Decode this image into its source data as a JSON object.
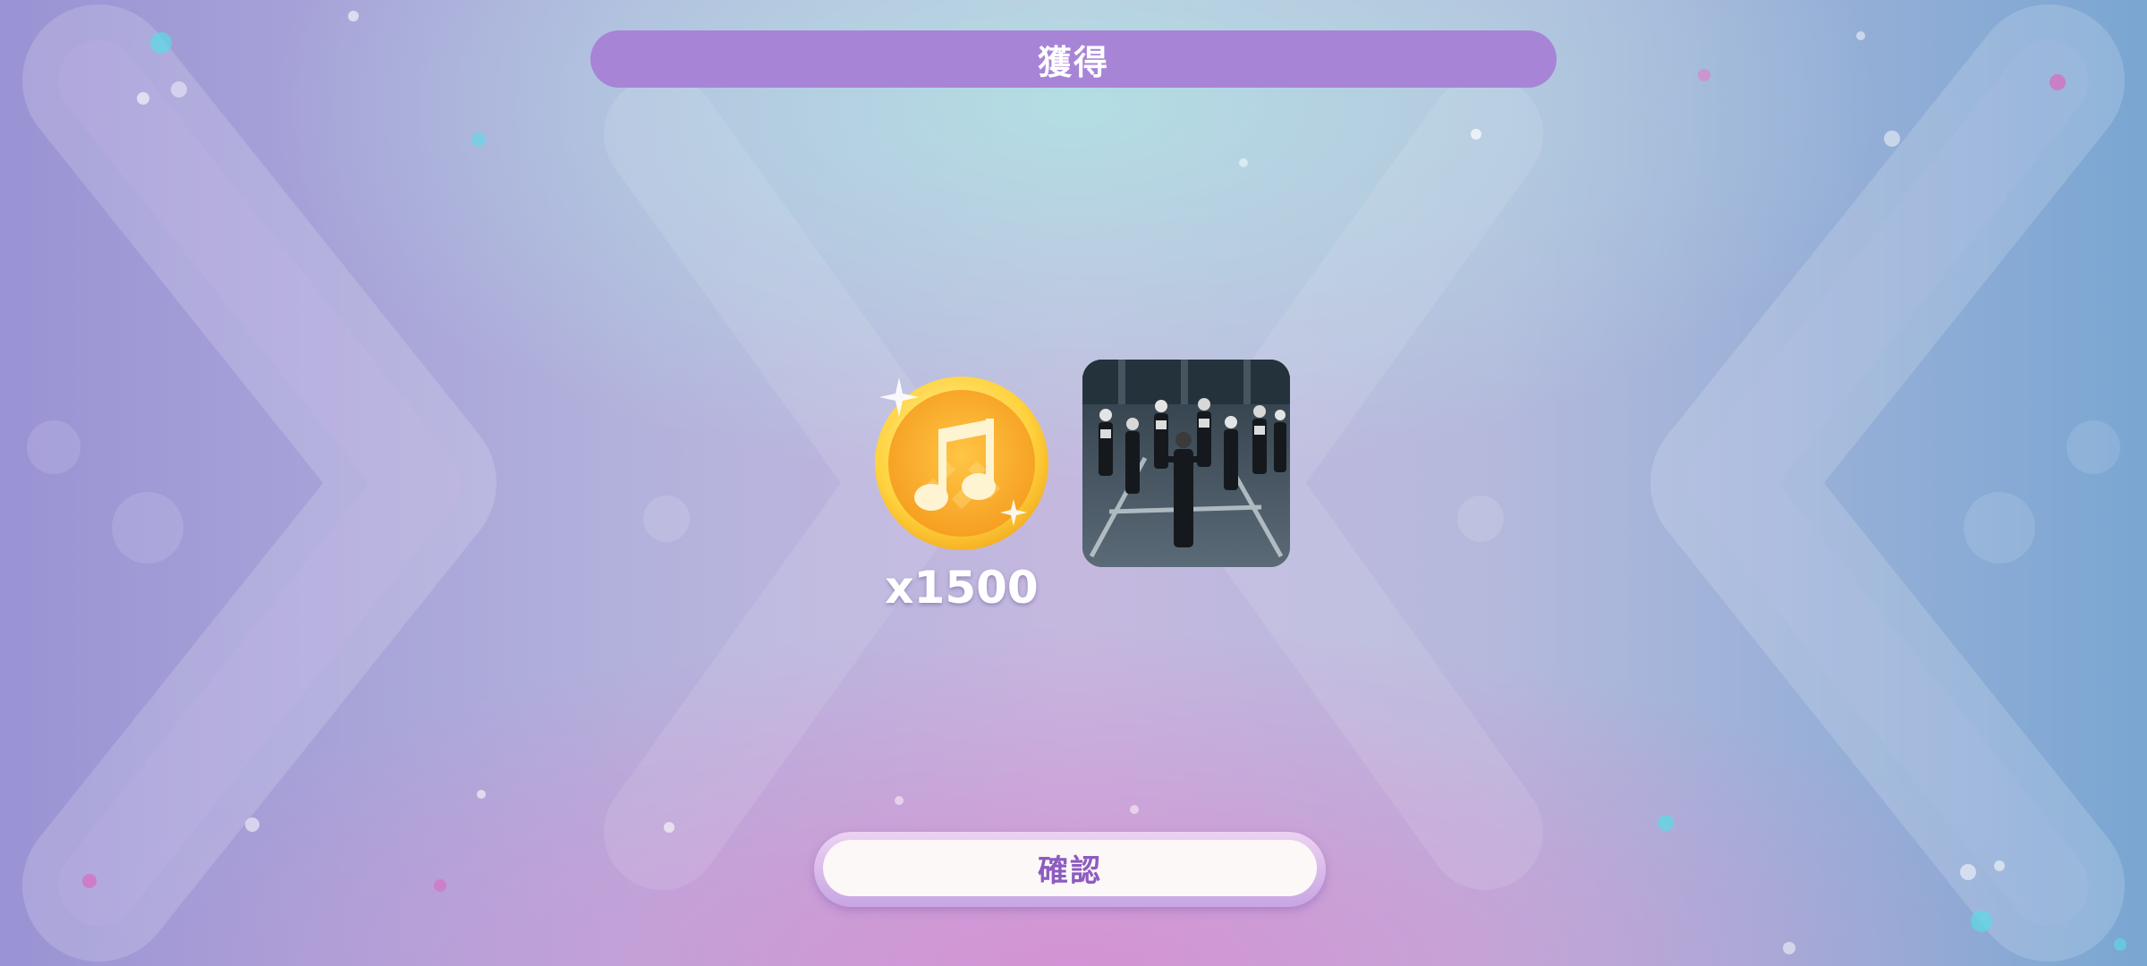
{
  "header": {
    "title": "獲得"
  },
  "rewards": [
    {
      "icon": "music-note-coin-icon",
      "count_text": "x1500"
    },
    {
      "icon": "music-video-thumbnail",
      "count_text": ""
    }
  ],
  "confirm": {
    "label": "確認"
  },
  "colors": {
    "banner": "#a784d6",
    "coin_gold": "#f7b52c",
    "confirm_text": "#8c5cbf"
  }
}
